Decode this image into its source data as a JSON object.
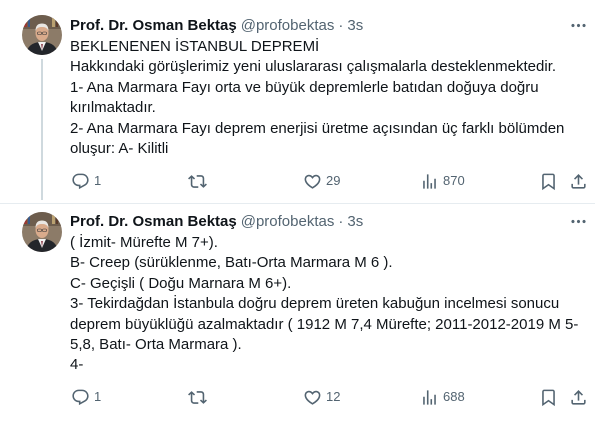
{
  "colors": {
    "background": "#ffffff",
    "text": "#0f1419",
    "secondary": "#536471",
    "divider": "#e6ecf0",
    "thread_line": "#cfd9de"
  },
  "icons": {
    "more": "more-icon",
    "reply": "reply-icon",
    "retweet": "retweet-icon",
    "like": "like-icon",
    "views": "views-icon",
    "bookmark": "bookmark-icon",
    "share": "share-icon"
  },
  "tweets": [
    {
      "author": {
        "name": "Prof. Dr. Osman Bektaş",
        "handle": "@profobektas",
        "separator": "·",
        "time": "3s"
      },
      "lines": [
        "BEKLENENEN İSTANBUL DEPREMİ",
        "Hakkındaki görüşlerimiz yeni uluslararası çalışmalarla desteklenmektedir.",
        "1- Ana Marmara Fayı orta ve büyük depremlerle batıdan doğuya doğru",
        "kırılmaktadır.",
        "2- Ana Marmara Fayı deprem enerjisi üretme açısından üç farklı bölümden",
        "oluşur: A- Kilitli"
      ],
      "stats": {
        "replies": "1",
        "likes": "29",
        "views": "870"
      }
    },
    {
      "author": {
        "name": "Prof. Dr. Osman Bektaş",
        "handle": "@profobektas",
        "separator": "·",
        "time": "3s"
      },
      "lines": [
        "( İzmit- Mürefte M 7+).",
        "B- Creep (sürüklenme, Batı-Orta Marmara M 6 ).",
        "C- Geçişli ( Doğu Marnara M 6+).",
        "3- Tekirdağdan İstanbula doğru deprem üreten kabuğun incelmesi sonucu",
        "deprem büyüklüğü azalmaktadır ( 1912 M 7,4 Mürefte; 2011-2012-2019 M 5-",
        "5,8, Batı- Orta Marmara ).",
        "4-"
      ],
      "stats": {
        "replies": "1",
        "likes": "12",
        "views": "688"
      }
    }
  ]
}
